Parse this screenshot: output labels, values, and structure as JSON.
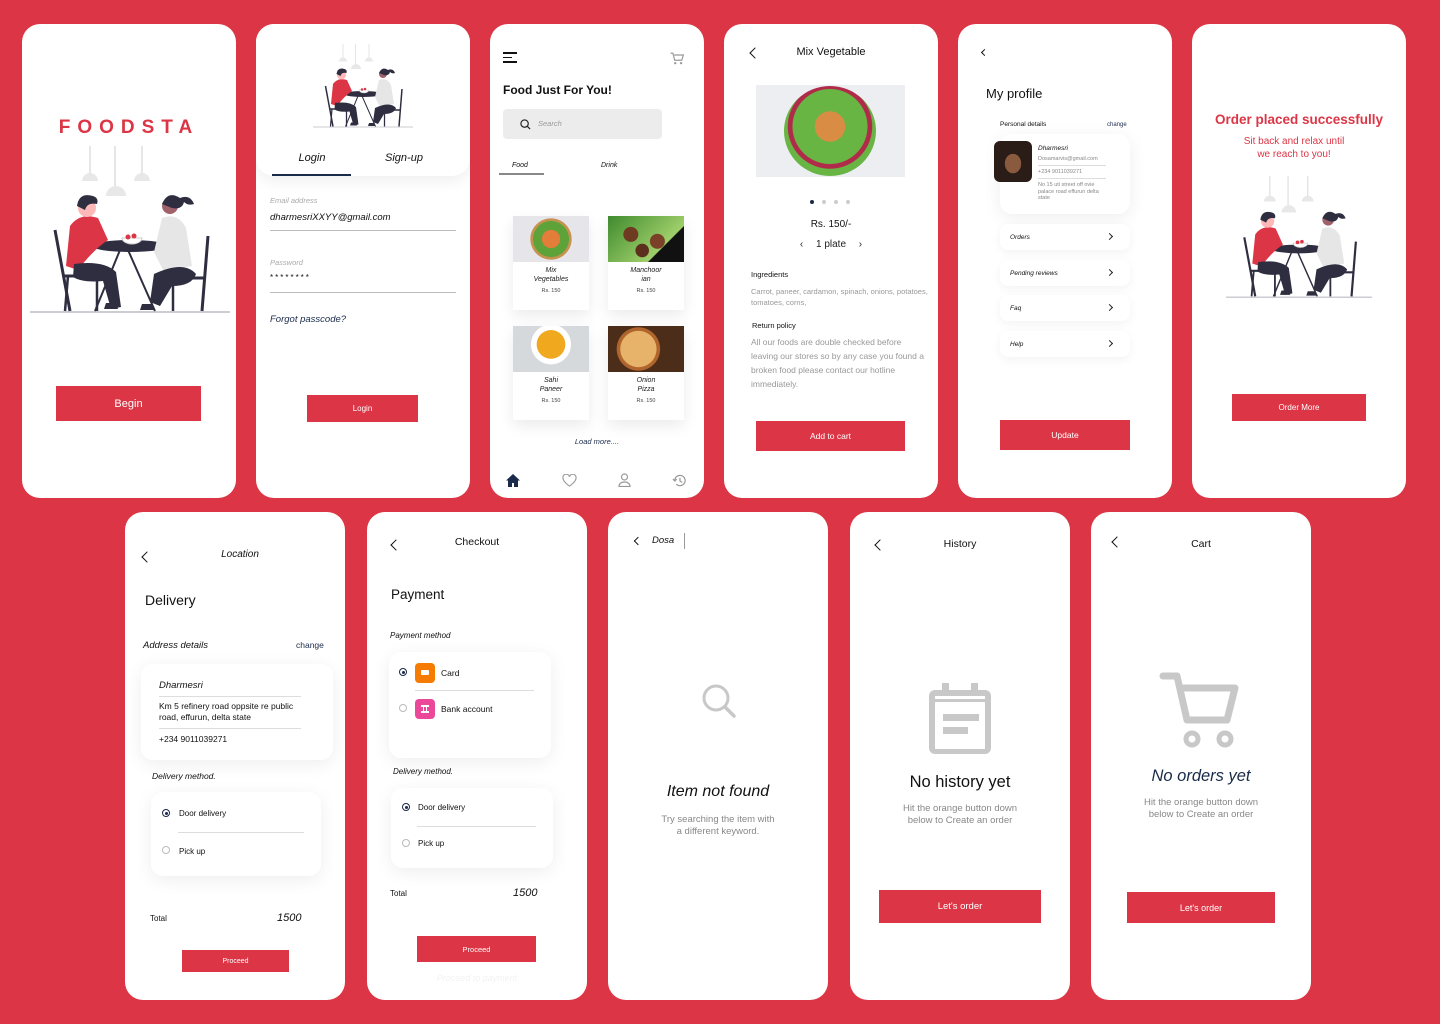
{
  "colors": {
    "brand": "#DC3545",
    "navy": "#1a2a4a",
    "grey_icon": "#C8C8C8",
    "card_orange": "#F57C00",
    "bank_pink": "#EC4899"
  },
  "splash": {
    "brand_name": "FOODSTA",
    "begin_label": "Begin",
    "illustration": "couple-dining-illustration"
  },
  "login": {
    "tabs": [
      "Login",
      "Sign-up"
    ],
    "active_tab": "Login",
    "email_label": "Email address",
    "email_value": "dharmesriXXYY@gmail.com",
    "password_label": "Password",
    "password_value": "********",
    "forgot_label": "Forgot passcode?",
    "login_label": "Login"
  },
  "home": {
    "title": "Food Just For You!",
    "search_placeholder": "Search",
    "tabs": [
      "Food",
      "Drink"
    ],
    "active_tab": "Food",
    "items": [
      {
        "name_line1": "Mix",
        "name_line2": "Vegetables",
        "price": "Rs. 150"
      },
      {
        "name_line1": "Manchoor",
        "name_line2": "ian",
        "price": "Rs. 150"
      },
      {
        "name_line1": "Sahi",
        "name_line2": "Paneer",
        "price": "Rs. 150"
      },
      {
        "name_line1": "Onion",
        "name_line2": "Pizza",
        "price": "Rs. 150"
      }
    ],
    "load_more": "Load more....",
    "nav": [
      "home",
      "favorites",
      "profile",
      "history"
    ],
    "active_nav": "home"
  },
  "detail": {
    "title": "Mix Vegetable",
    "price": "Rs. 150/-",
    "quantity": "1 plate",
    "carousel_count": 4,
    "carousel_active": 1,
    "ingredients_label": "Ingredients",
    "ingredients": "Carrot, paneer, cardamon, spinach, onions, potatoes, tomatoes, corns,",
    "return_label": "Return policy",
    "return_text": "All our foods are double checked before leaving our stores so by any case you found a broken food please contact our hotline immediately.",
    "add_to_cart": "Add to cart"
  },
  "profile": {
    "title": "My profile",
    "section": "Personal details",
    "change": "change",
    "name": "Dharmesri",
    "email": "Dosamarvis@gmail.com",
    "phone": "+234 9011039271",
    "address": "No 15 uti street off ovie palace road effurun delta state",
    "menu": [
      "Orders",
      "Pending reviews",
      "Faq",
      "Help"
    ],
    "update": "Update"
  },
  "success": {
    "title": "Order placed successfully",
    "subtitle_line1": "Sit back and relax until",
    "subtitle_line2": "we reach to you!",
    "button": "Order More"
  },
  "location": {
    "header": "Location",
    "title": "Delivery",
    "address_label": "Address details",
    "change": "change",
    "name": "Dharmesri",
    "address": "Km 5 refinery road oppsite re public road, effurun, delta state",
    "phone": "+234 9011039271",
    "method_label": "Delivery method.",
    "methods": [
      "Door delivery",
      "Pick up"
    ],
    "selected_method": "Door delivery",
    "total_label": "Total",
    "total_value": "1500",
    "proceed": "Proceed"
  },
  "checkout": {
    "header": "Checkout",
    "title": "Payment",
    "payment_label": "Payment method",
    "payments": [
      "Card",
      "Bank account"
    ],
    "selected_payment": "Card",
    "method_label": "Delivery method.",
    "methods": [
      "Door delivery",
      "Pick up"
    ],
    "selected_method": "Door delivery",
    "total_label": "Total",
    "total_value": "1500",
    "proceed": "Proceed",
    "ghost_text": "Proceed to payment"
  },
  "search_empty": {
    "query": "Dosa",
    "title": "Item not found",
    "subtitle_line1": "Try searching the item with",
    "subtitle_line2": "a different keyword."
  },
  "history": {
    "header": "History",
    "title": "No history yet",
    "subtitle_line1": "Hit the orange button down",
    "subtitle_line2": "below to Create an order",
    "button": "Let's order"
  },
  "cart": {
    "header": "Cart",
    "title": "No orders yet",
    "subtitle_line1": "Hit the orange button down",
    "subtitle_line2": "below to Create an order",
    "button": "Let's order"
  }
}
